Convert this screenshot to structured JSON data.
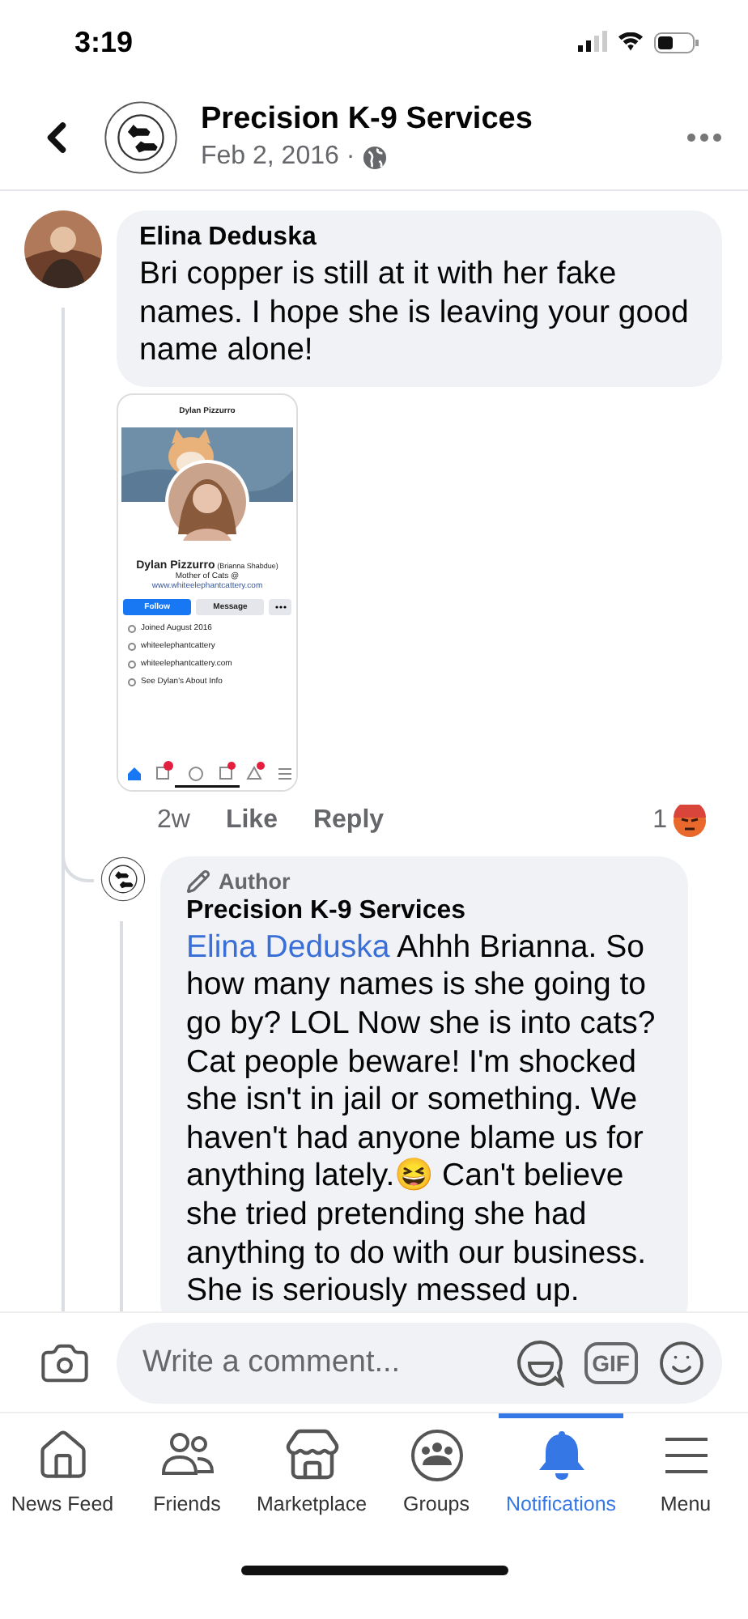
{
  "status_bar": {
    "time": "3:19"
  },
  "post_header": {
    "page_name": "Precision K-9 Services",
    "date": "Feb 2, 2016 ·"
  },
  "comments": [
    {
      "author": "Elina Deduska",
      "text": "Bri copper is still at it with her fake names. I hope she is leaving your good name alone!",
      "attachment": {
        "header_title": "Dylan Pizzurro",
        "name": "Dylan Pizzurro",
        "alt_name": "(Brianna Shabdue)",
        "bio": "Mother of Cats @",
        "website": "www.whiteelephantcattery.com",
        "follow": "Follow",
        "message": "Message",
        "details": [
          "Joined August 2016",
          "whiteelephantcattery",
          "whiteelephantcattery.com",
          "See Dylan's About Info"
        ]
      },
      "time": "2w",
      "actions": [
        "Like",
        "Reply"
      ],
      "reaction_count": "1",
      "replies": [
        {
          "badge": "Author",
          "author": "Precision K-9 Services",
          "mention": "Elina Deduska",
          "text": "Ahhh Brianna. So how many names is she going to go by? LOL Now she is into cats? Cat people beware! I'm shocked she isn't in jail or something. We haven't had anyone blame us for anything lately.😆 Can't believe she tried pretending she had anything to do with our business. She is seriously messed up."
        }
      ]
    }
  ],
  "composer": {
    "placeholder": "Write a comment...",
    "gif_label": "GIF"
  },
  "tabs": [
    {
      "label": "News Feed",
      "selected": false
    },
    {
      "label": "Friends",
      "selected": false
    },
    {
      "label": "Marketplace",
      "selected": false
    },
    {
      "label": "Groups",
      "selected": false
    },
    {
      "label": "Notifications",
      "selected": true
    },
    {
      "label": "Menu",
      "selected": false
    }
  ]
}
